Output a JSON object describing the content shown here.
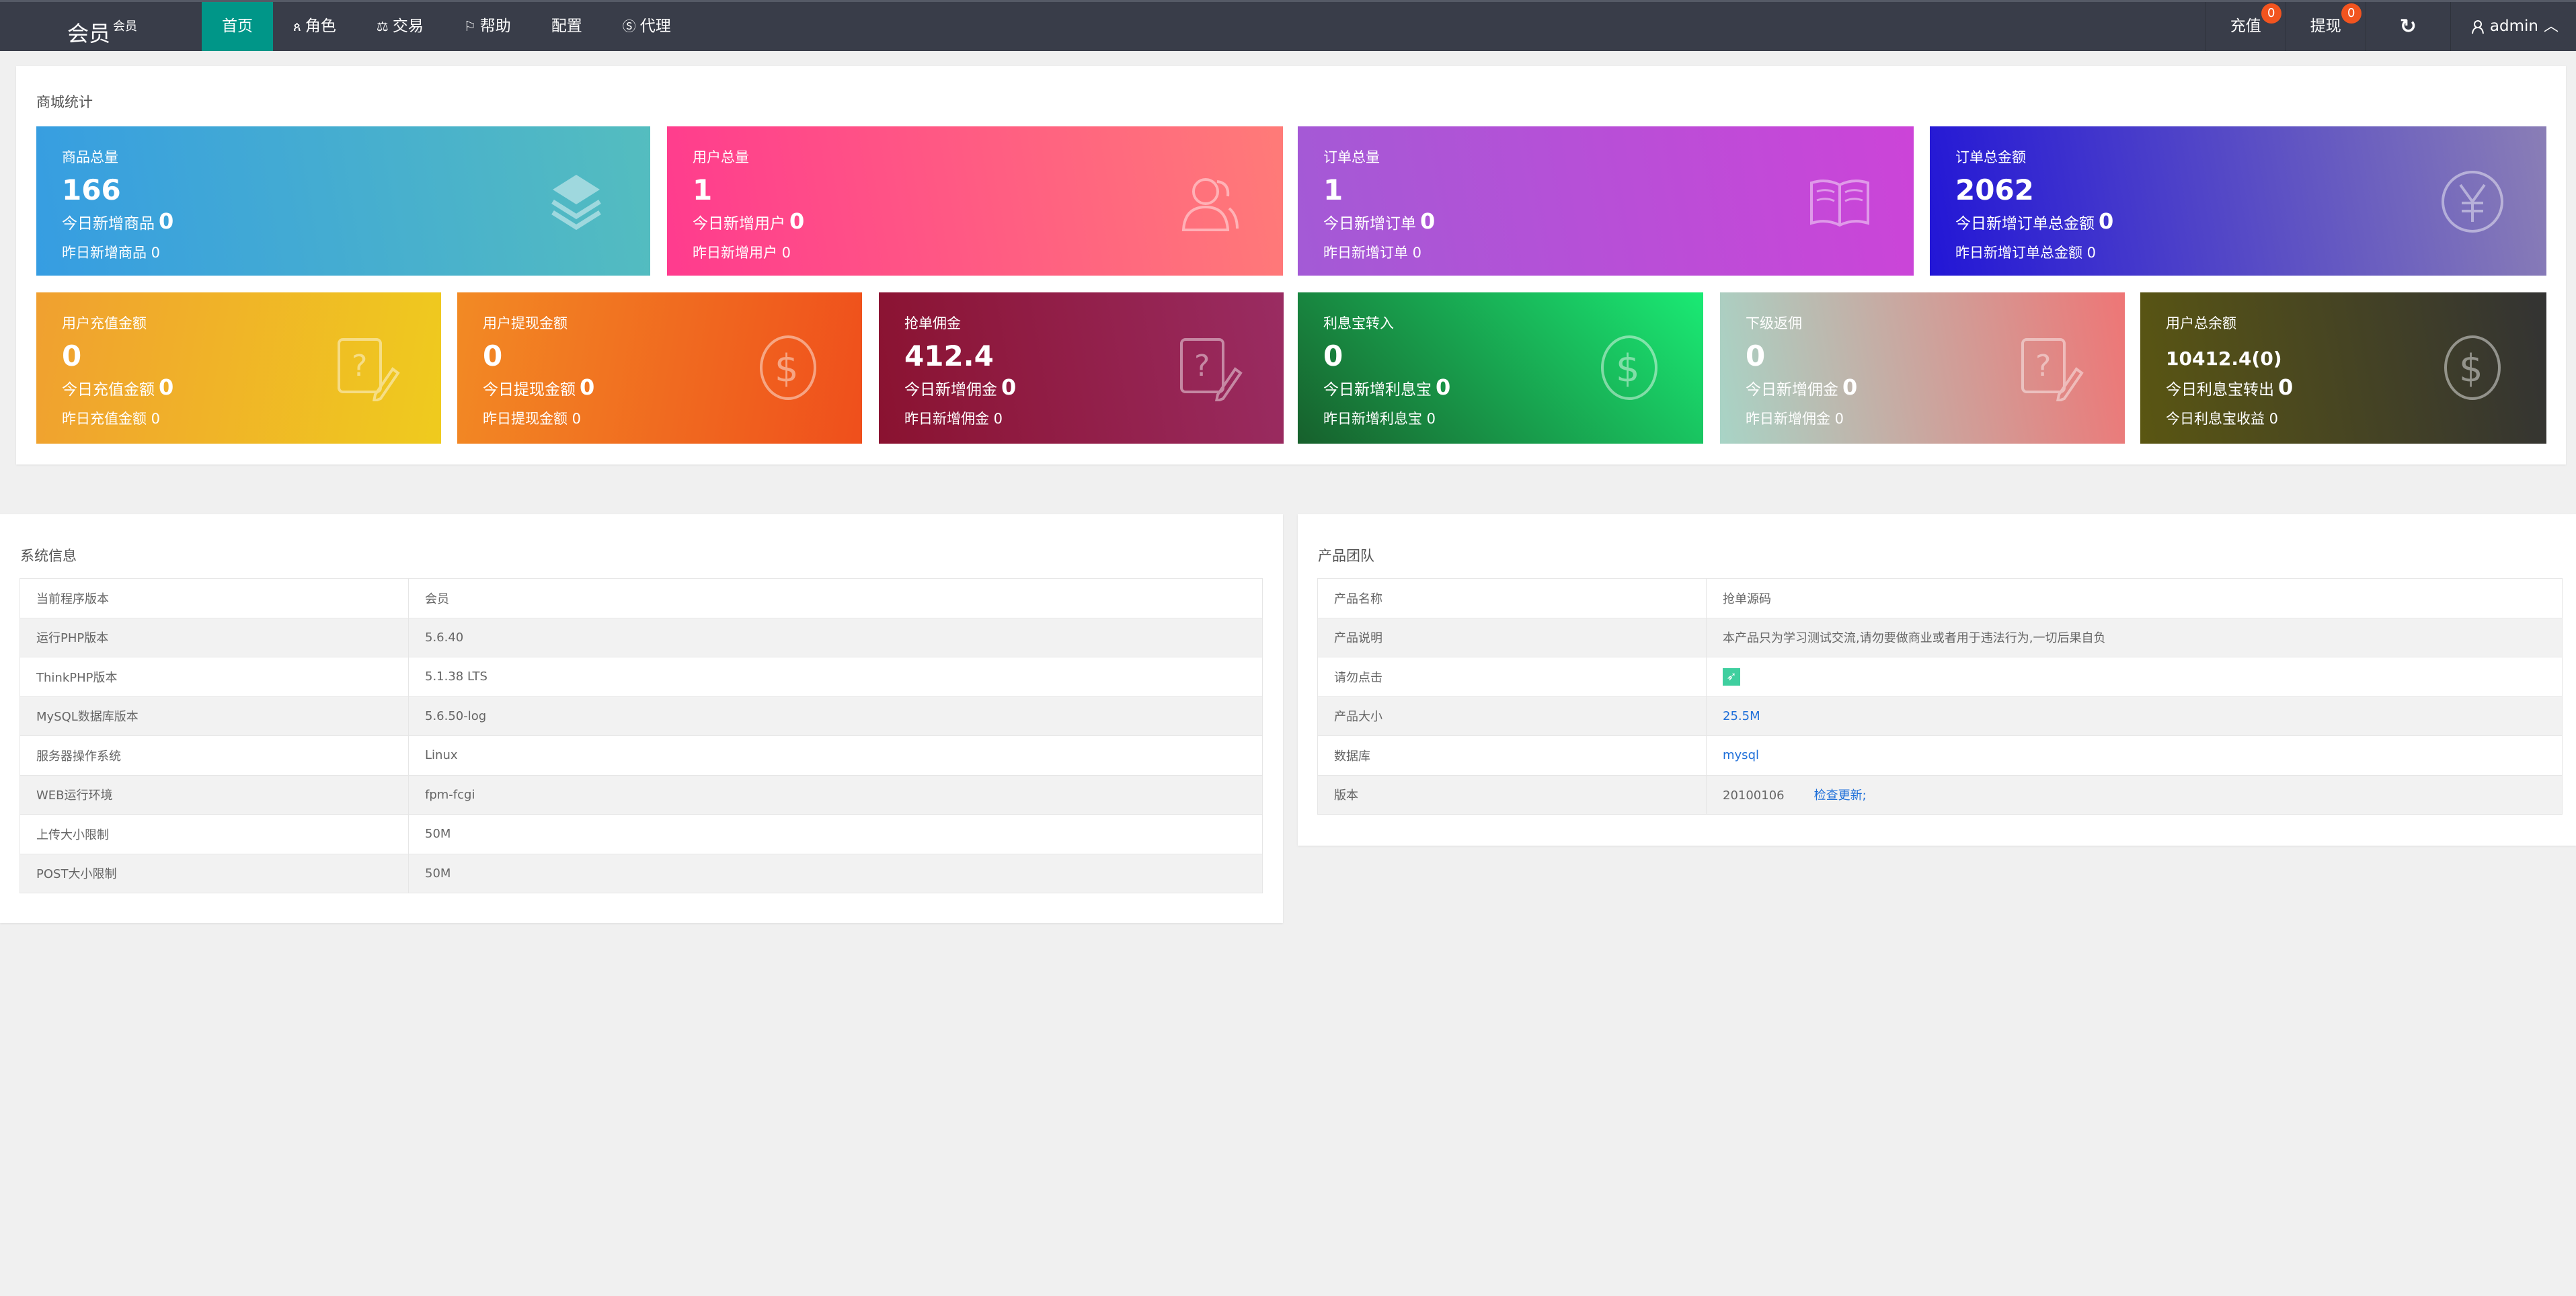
{
  "header": {
    "logo": "会员",
    "logo_sup": "会员",
    "nav": [
      {
        "label": "首页",
        "icon": ""
      },
      {
        "label": "角色",
        "icon": "user-icon"
      },
      {
        "label": "交易",
        "icon": "scale-icon"
      },
      {
        "label": "帮助",
        "icon": "flag-icon"
      },
      {
        "label": "配置",
        "icon": ""
      },
      {
        "label": "代理",
        "icon": "dollar-icon"
      }
    ],
    "recharge": {
      "label": "充值",
      "badge": "0"
    },
    "withdraw": {
      "label": "提现",
      "badge": "0"
    },
    "user": "admin"
  },
  "stats": {
    "title": "商城统计",
    "cards": [
      {
        "label": "商品总量",
        "value": "166",
        "l1": "今日新增商品",
        "v1": "0",
        "l2": "昨日新增商品 0",
        "icon": "layers-icon",
        "gradient": [
          "#369de2",
          "#54bdbf"
        ]
      },
      {
        "label": "用户总量",
        "value": "1",
        "l1": "今日新增用户",
        "v1": "0",
        "l2": "昨日新增用户 0",
        "icon": "users-icon",
        "gradient": [
          "#ff3b8e",
          "#ff7b78"
        ]
      },
      {
        "label": "订单总量",
        "value": "1",
        "l1": "今日新增订单",
        "v1": "0",
        "l2": "昨日新增订单 0",
        "icon": "book-icon",
        "gradient": [
          "#a35ad6",
          "#cc44d8"
        ]
      },
      {
        "label": "订单总金额",
        "value": "2062",
        "l1": "今日新增订单总金额",
        "v1": "0",
        "l2": "昨日新增订单总金额 0",
        "icon": "yen-icon",
        "gradient": [
          "#2216d6",
          "#8a7eb6"
        ]
      },
      {
        "label": "用户充值金额",
        "value": "0",
        "l1": "今日充值金额",
        "v1": "0",
        "l2": "昨日充值金额 0",
        "icon": "question-edit-icon",
        "gradient": [
          "#f0a030",
          "#efcb1e"
        ]
      },
      {
        "label": "用户提现金额",
        "value": "0",
        "l1": "今日提现金额",
        "v1": "0",
        "l2": "昨日提现金额 0",
        "icon": "dollar-circle-icon",
        "gradient": [
          "#f28a24",
          "#ef4f1c"
        ]
      },
      {
        "label": "抢单佣金",
        "value": "412.4",
        "l1": "今日新增佣金",
        "v1": "0",
        "l2": "昨日新增佣金 0",
        "icon": "question-edit-icon",
        "gradient": [
          "#8a1230",
          "#9a2c62"
        ]
      },
      {
        "label": "利息宝转入",
        "value": "0",
        "l1": "今日新增利息宝",
        "v1": "0",
        "l2": "昨日新增利息宝 0",
        "icon": "dollar-circle-icon",
        "gradient": [
          "#17602c",
          "#1aea74"
        ]
      },
      {
        "label": "下级返佣",
        "value": "0",
        "l1": "今日新增佣金",
        "v1": "0",
        "l2": "昨日新增佣金 0",
        "icon": "question-edit-icon",
        "gradient": [
          "#a8d4c6",
          "#ee7676"
        ]
      },
      {
        "label": "用户总余额",
        "value": "10412.4(0)",
        "l1": "今日利息宝转出",
        "v1": "0",
        "l2": "今日利息宝收益 0",
        "icon": "dollar-circle-icon",
        "gradient": [
          "#5a5612",
          "#333333"
        ]
      }
    ]
  },
  "system": {
    "title": "系统信息",
    "rows": [
      [
        "当前程序版本",
        "会员"
      ],
      [
        "运行PHP版本",
        "5.6.40"
      ],
      [
        "ThinkPHP版本",
        "5.1.38 LTS"
      ],
      [
        "MySQL数据库版本",
        "5.6.50-log"
      ],
      [
        "服务器操作系统",
        "Linux"
      ],
      [
        "WEB运行环境",
        "fpm-fcgi"
      ],
      [
        "上传大小限制",
        "50M"
      ],
      [
        "POST大小限制",
        "50M"
      ]
    ]
  },
  "team": {
    "title": "产品团队",
    "name": [
      "产品名称",
      "抢单源码"
    ],
    "desc": [
      "产品说明",
      "本产品只为学习测试交流,请勿要做商业或者用于违法行为,一切后果自负"
    ],
    "click": [
      "请勿点击"
    ],
    "size": [
      "产品大小",
      "25.5M"
    ],
    "db": [
      "数据库",
      "mysql"
    ],
    "version": [
      "版本",
      "20100106"
    ],
    "check_update": "检查更新;"
  }
}
